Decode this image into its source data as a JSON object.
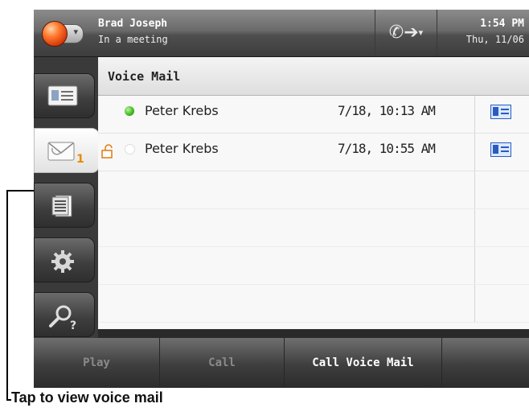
{
  "status_bar": {
    "user_name": "Brad Joseph",
    "presence_status": "In a meeting",
    "time": "1:54 PM",
    "date": "Thu, 11/06",
    "presence_color": "#e8541a"
  },
  "sidebar": {
    "items": [
      {
        "name": "contacts",
        "icon": "contact-card-icon"
      },
      {
        "name": "voicemail",
        "icon": "voicemail-envelope-icon",
        "badge": "1",
        "active": true
      },
      {
        "name": "call-log",
        "icon": "call-log-icon"
      },
      {
        "name": "settings",
        "icon": "gear-icon"
      },
      {
        "name": "search",
        "icon": "search-help-icon"
      }
    ]
  },
  "voicemail": {
    "title": "Voice Mail",
    "messages": [
      {
        "caller": "Peter Krebs",
        "timestamp": "7/18, 10:13 AM",
        "status": "unread",
        "locked": false
      },
      {
        "caller": "Peter Krebs",
        "timestamp": "7/18, 10:55 AM",
        "status": "read",
        "locked": true
      }
    ]
  },
  "softkeys": {
    "play": "Play",
    "call": "Call",
    "call_voice_mail": "Call Voice Mail"
  },
  "callout": {
    "text": "Tap to view voice mail"
  }
}
